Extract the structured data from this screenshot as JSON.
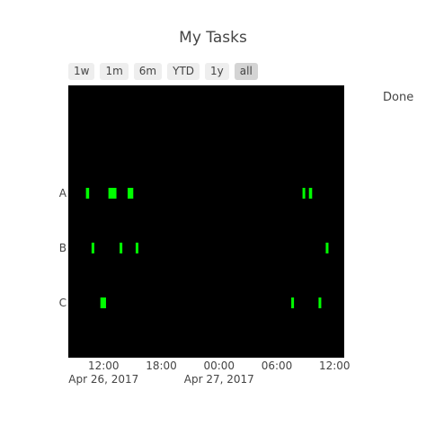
{
  "chart_data": {
    "type": "gantt",
    "title": "My Tasks",
    "range_buttons": [
      "1w",
      "1m",
      "6m",
      "YTD",
      "1y",
      "all"
    ],
    "active_range": "all",
    "legend": [
      "Done"
    ],
    "colors": {
      "plot_bg": "#000000",
      "bar": "#00ff00"
    },
    "x_ticks": [
      {
        "time": "2017-04-26 12:00",
        "label": "12:00",
        "sublabel": "Apr 26, 2017"
      },
      {
        "time": "2017-04-26 18:00",
        "label": "18:00",
        "sublabel": ""
      },
      {
        "time": "2017-04-27 00:00",
        "label": "00:00",
        "sublabel": "Apr 27, 2017"
      },
      {
        "time": "2017-04-27 06:00",
        "label": "06:00",
        "sublabel": ""
      },
      {
        "time": "2017-04-27 12:00",
        "label": "12:00",
        "sublabel": ""
      }
    ],
    "x_range": [
      "2017-04-26 08:20",
      "2017-04-27 13:00"
    ],
    "categories": [
      "A",
      "B",
      "C"
    ],
    "tasks": [
      {
        "task": "A",
        "start": "2017-04-26 10:10",
        "finish": "2017-04-26 10:30"
      },
      {
        "task": "A",
        "start": "2017-04-26 12:30",
        "finish": "2017-04-26 13:20"
      },
      {
        "task": "A",
        "start": "2017-04-26 14:30",
        "finish": "2017-04-26 15:05"
      },
      {
        "task": "A",
        "start": "2017-04-27 08:40",
        "finish": "2017-04-27 08:55"
      },
      {
        "task": "A",
        "start": "2017-04-27 09:20",
        "finish": "2017-04-27 09:40"
      },
      {
        "task": "B",
        "start": "2017-04-26 10:45",
        "finish": "2017-04-26 10:55"
      },
      {
        "task": "B",
        "start": "2017-04-26 13:40",
        "finish": "2017-04-26 13:52"
      },
      {
        "task": "B",
        "start": "2017-04-26 15:20",
        "finish": "2017-04-26 15:30"
      },
      {
        "task": "B",
        "start": "2017-04-27 11:05",
        "finish": "2017-04-27 11:18"
      },
      {
        "task": "C",
        "start": "2017-04-26 11:40",
        "finish": "2017-04-26 12:15"
      },
      {
        "task": "C",
        "start": "2017-04-27 07:30",
        "finish": "2017-04-27 07:42"
      },
      {
        "task": "C",
        "start": "2017-04-27 10:20",
        "finish": "2017-04-27 10:35"
      }
    ]
  }
}
